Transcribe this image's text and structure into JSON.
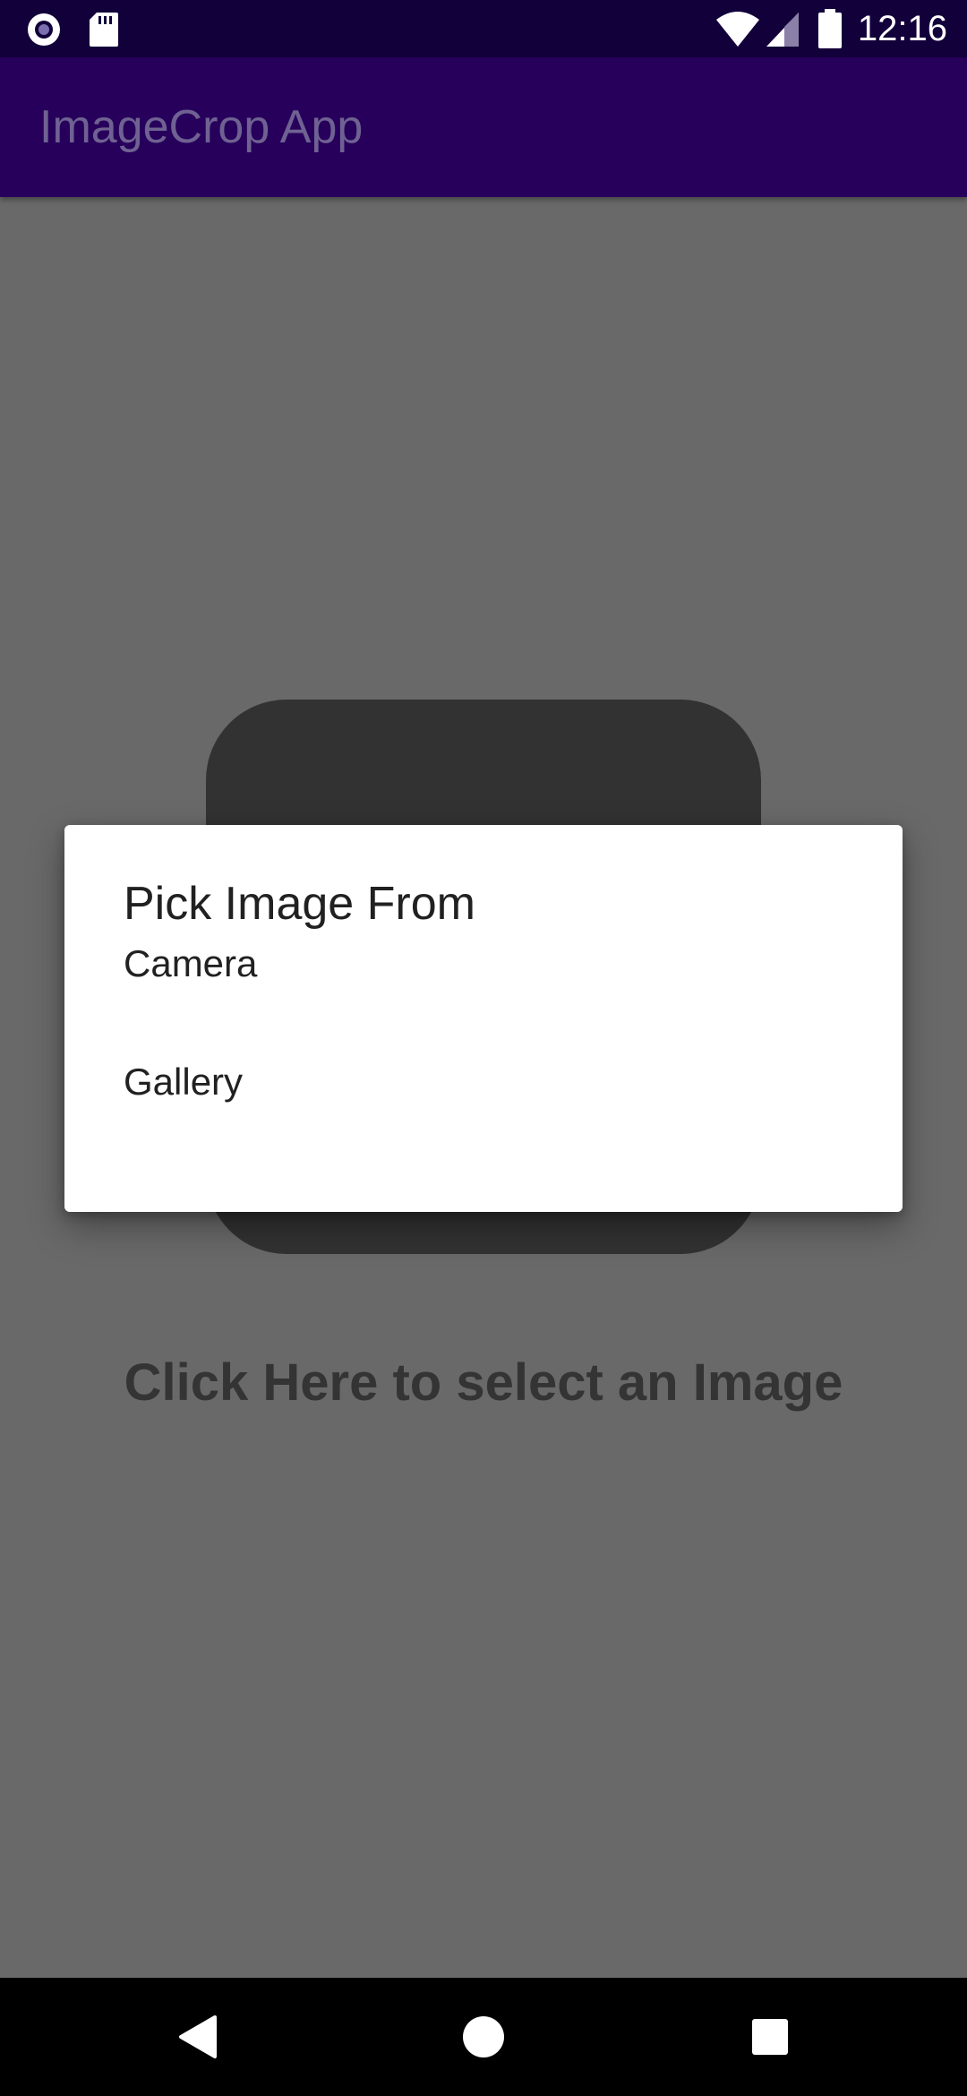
{
  "status_bar": {
    "time": "12:16",
    "icons": [
      "notification-circle-icon",
      "sd-card-icon",
      "wifi-icon",
      "signal-icon",
      "battery-icon"
    ]
  },
  "app_bar": {
    "title": "ImageCrop App"
  },
  "main": {
    "prompt_text": "Click Here to select an Image"
  },
  "dialog": {
    "title": "Pick Image From",
    "options": [
      {
        "label": "Camera"
      },
      {
        "label": "Gallery"
      }
    ]
  },
  "nav_bar": {
    "buttons": [
      "back-icon",
      "home-icon",
      "recents-icon"
    ]
  },
  "colors": {
    "status_bar": "#12003a",
    "app_bar": "#27005c",
    "scrim_background": "#696969",
    "dialog_background": "#ffffff"
  }
}
